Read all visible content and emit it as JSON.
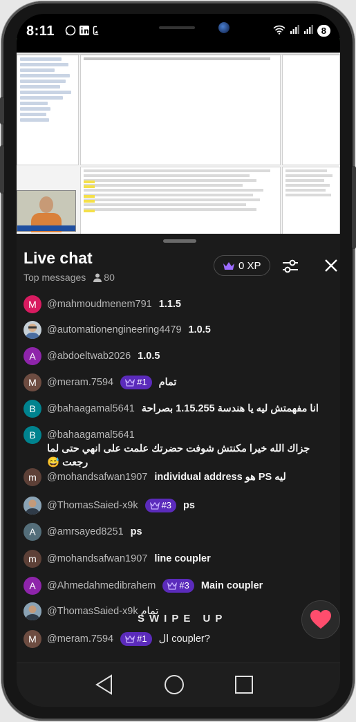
{
  "status_bar": {
    "time": "8:11",
    "left_icons": [
      "whatsapp-icon",
      "linkedin-icon",
      "gallery-icon"
    ],
    "right_icons": [
      "wifi-icon",
      "signal-icon",
      "signal-icon"
    ],
    "battery": "8"
  },
  "chat": {
    "title": "Live chat",
    "mode": "Top messages",
    "viewer_count": "80",
    "xp_label": "0 XP"
  },
  "messages": [
    {
      "author": "@mahmoudmenem791",
      "text": "1.1.5",
      "avatar_letter": "M",
      "avatar_color": "#d81b60"
    },
    {
      "author": "@automationengineering4479",
      "text": "1.0.5",
      "avatar_letter": "",
      "avatar_color": "#607d8b"
    },
    {
      "author": "@abdoeltwab2026",
      "text": "1.0.5",
      "avatar_letter": "A",
      "avatar_color": "#8e24aa"
    },
    {
      "author": "@meram.7594",
      "badge": "#1",
      "text": "تمام",
      "avatar_letter": "M",
      "avatar_color": "#6d4c41"
    },
    {
      "author": "@bahaagamal5641",
      "text": "انا مفهمتش ليه يا هندسة 1.15.255 بصراحة",
      "avatar_letter": "B",
      "avatar_color": "#00838f"
    },
    {
      "author": "@bahaagamal5641",
      "text": "جزاك الله خيرا مكنتش شوفت حضرتك علمت على انهي حتى لما رجعت 😅",
      "avatar_letter": "B",
      "avatar_color": "#00838f"
    },
    {
      "author": "@mohandsafwan1907",
      "text": "ليه PS هو individual address",
      "avatar_letter": "m",
      "avatar_color": "#5d4037"
    },
    {
      "author": "@ThomasSaied-x9k",
      "badge": "#3",
      "text": "ps",
      "avatar_letter": "",
      "avatar_color": "#78909c"
    },
    {
      "author": "@amrsayed8251",
      "text": "ps",
      "avatar_letter": "A",
      "avatar_color": "#546e7a"
    },
    {
      "author": "@mohandsafwan1907",
      "text": "line coupler",
      "avatar_letter": "m",
      "avatar_color": "#5d4037"
    },
    {
      "author": "@Ahmedahmedibrahem",
      "badge": "#3",
      "text": "Main coupler",
      "avatar_letter": "A",
      "avatar_color": "#8e24aa"
    },
    {
      "author": "@ThomasSaied-x9k",
      "text": "تمام",
      "avatar_letter": "",
      "avatar_color": "#78909c"
    },
    {
      "author": "@meram.7594",
      "badge": "#1",
      "text": "ال coupler?",
      "avatar_letter": "M",
      "avatar_color": "#6d4c41"
    }
  ],
  "overlay": {
    "swipe_up": "SWIPE UP"
  },
  "colors": {
    "badge": "#5b2bbb",
    "crown": "#a98bff",
    "heart": "#ff4d6d"
  }
}
